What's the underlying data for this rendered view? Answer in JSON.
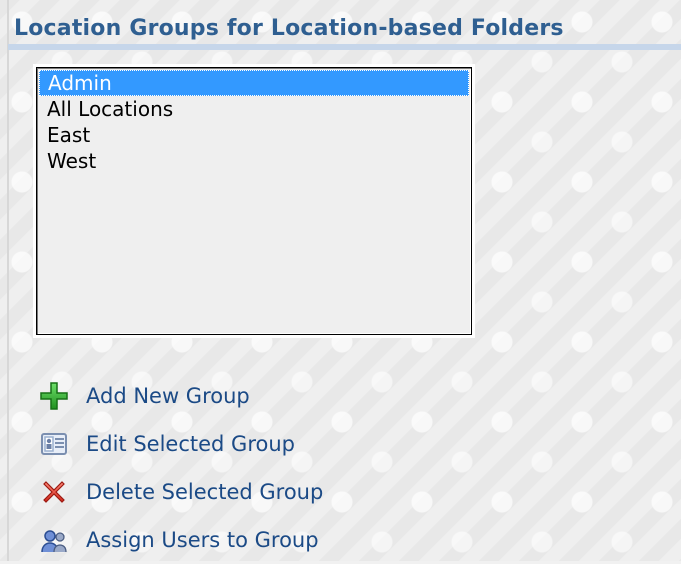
{
  "header": {
    "title": "Location Groups for Location-based Folders"
  },
  "locationGroups": {
    "items": [
      {
        "label": "Admin",
        "selected": true
      },
      {
        "label": "All Locations",
        "selected": false
      },
      {
        "label": "East",
        "selected": false
      },
      {
        "label": "West",
        "selected": false
      }
    ]
  },
  "actions": [
    {
      "label": "Add New Group",
      "icon": "add-icon"
    },
    {
      "label": "Edit Selected Group",
      "icon": "edit-icon"
    },
    {
      "label": "Delete Selected Group",
      "icon": "delete-icon"
    },
    {
      "label": "Assign Users to Group",
      "icon": "users-icon"
    }
  ],
  "colors": {
    "headerText": "#2f5f91",
    "linkText": "#1b4a86",
    "selectionBg": "#3399ff",
    "addGreen": "#2aa52a",
    "deleteRed": "#e34b3b"
  }
}
